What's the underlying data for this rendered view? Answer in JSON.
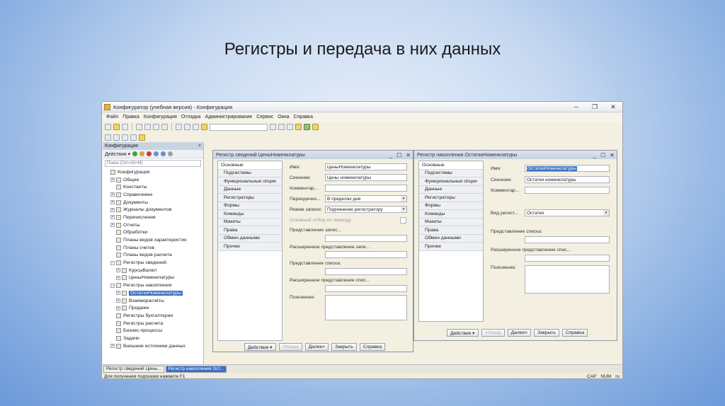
{
  "slide_title": "Регистры и передача в них данных",
  "window": {
    "title": "Конфигуратор (учебная версия) - Конфигурация",
    "minimize": "─",
    "restore": "❐",
    "close": "✕"
  },
  "menu": [
    "Файл",
    "Правка",
    "Конфигурация",
    "Отладка",
    "Администрирование",
    "Сервис",
    "Окна",
    "Справка"
  ],
  "left_panel": {
    "header": "Конфигурация",
    "close": "×",
    "actions_label": "Действия ▾",
    "search_placeholder": "Поиск (Ctrl+Alt+M)",
    "tree": [
      {
        "label": "Конфигурация",
        "indent": 0,
        "expander": ""
      },
      {
        "label": "Общие",
        "indent": 1,
        "expander": "+"
      },
      {
        "label": "Константы",
        "indent": 1,
        "expander": ""
      },
      {
        "label": "Справочники",
        "indent": 1,
        "expander": "+"
      },
      {
        "label": "Документы",
        "indent": 1,
        "expander": "+"
      },
      {
        "label": "Журналы документов",
        "indent": 1,
        "expander": "+"
      },
      {
        "label": "Перечисления",
        "indent": 1,
        "expander": "+"
      },
      {
        "label": "Отчеты",
        "indent": 1,
        "expander": "+"
      },
      {
        "label": "Обработки",
        "indent": 1,
        "expander": ""
      },
      {
        "label": "Планы видов характеристик",
        "indent": 1,
        "expander": ""
      },
      {
        "label": "Планы счетов",
        "indent": 1,
        "expander": ""
      },
      {
        "label": "Планы видов расчета",
        "indent": 1,
        "expander": ""
      },
      {
        "label": "Регистры сведений",
        "indent": 1,
        "expander": "−"
      },
      {
        "label": "КурсыВалют",
        "indent": 2,
        "expander": "+"
      },
      {
        "label": "ЦеныНоменклатуры",
        "indent": 2,
        "expander": "+"
      },
      {
        "label": "Регистры накопления",
        "indent": 1,
        "expander": "−"
      },
      {
        "label": "ОстаткиНоменклатуры",
        "indent": 2,
        "expander": "+",
        "selected": true
      },
      {
        "label": "Взаиморасчёты",
        "indent": 2,
        "expander": "+"
      },
      {
        "label": "Продажи",
        "indent": 2,
        "expander": "+"
      },
      {
        "label": "Регистры бухгалтерии",
        "indent": 1,
        "expander": ""
      },
      {
        "label": "Регистры расчета",
        "indent": 1,
        "expander": ""
      },
      {
        "label": "Бизнес-процессы",
        "indent": 1,
        "expander": ""
      },
      {
        "label": "Задачи",
        "indent": 1,
        "expander": ""
      },
      {
        "label": "Внешние источники данных",
        "indent": 1,
        "expander": "+"
      }
    ]
  },
  "dialog1": {
    "title": "Регистр сведений ЦеныНоменклатуры",
    "tabs": [
      "Основные",
      "Подсистемы",
      "Функциональные опции",
      "Данные",
      "Регистраторы",
      "Формы",
      "Команды",
      "Макеты",
      "Права",
      "Обмен данными",
      "Прочее"
    ],
    "fields": {
      "name_label": "Имя:",
      "name_value": "ЦеныНоменклатуры",
      "synonym_label": "Синоним:",
      "synonym_value": "Цены номенклатуры",
      "comment_label": "Комментар...",
      "comment_value": "",
      "period_label": "Периодично...",
      "period_value": "В пределах дня",
      "mode_label": "Режим записи:",
      "mode_value": "Подчинение регистратору",
      "main_filter_label": "Основной отбор по периоду",
      "record_repr_label": "Представление запис...",
      "ext_record_repr_label": "Расширенное представление запи...",
      "list_repr_label": "Представление списка:",
      "ext_list_repr_label": "Расширенное представление спис...",
      "note_label": "Пояснение:"
    },
    "buttons": {
      "actions": "Действия ▾",
      "back": "<Назад",
      "next": "Далее>",
      "close": "Закрыть",
      "help": "Справка"
    }
  },
  "dialog2": {
    "title": "Регистр накопления ОстаткиНоменклатуры",
    "tabs": [
      "Основные",
      "Подсистемы",
      "Функциональные опции",
      "Данные",
      "Регистраторы",
      "Формы",
      "Команды",
      "Макеты",
      "Права",
      "Обмен данными",
      "Прочее"
    ],
    "fields": {
      "name_label": "Имя:",
      "name_value": "ОстаткиНоменклатуры",
      "synonym_label": "Синоним:",
      "synonym_value": "Остатки номенклатуры",
      "comment_label": "Комментар...",
      "comment_value": "",
      "kind_label": "Вид регист...",
      "kind_value": "Остатки",
      "list_repr_label": "Представление списка:",
      "ext_list_repr_label": "Расширенное представление спис...",
      "note_label": "Пояснение:"
    },
    "buttons": {
      "actions": "Действия ▾",
      "back": "<Назад",
      "next": "Далее>",
      "close": "Закрыть",
      "help": "Справка"
    }
  },
  "taskbar": [
    "Регистр сведений Цены...",
    "Регистр накопления Ост..."
  ],
  "status": {
    "hint": "Для получения подсказки нажмите F1",
    "cap": "CAP",
    "num": "NUM",
    "lang": "ru"
  }
}
